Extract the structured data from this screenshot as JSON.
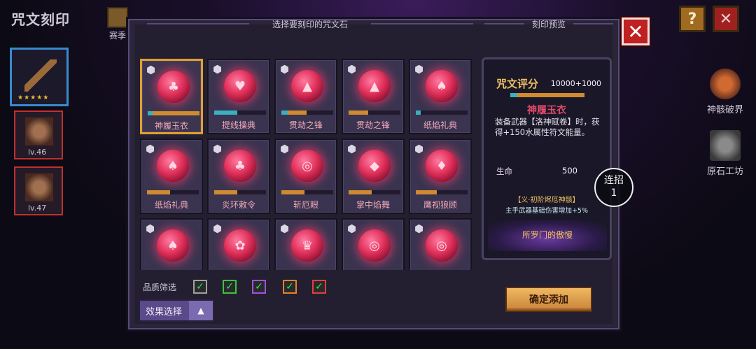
{
  "background": {
    "title": "咒文刻印",
    "season_label": "赛季",
    "hero_levels": [
      "lv.46",
      "lv.47"
    ],
    "side_features": [
      "神骸破界",
      "原石工坊"
    ],
    "help_label": "?",
    "close_label": "✕"
  },
  "panel": {
    "left_header": "选择要刻印的咒文石",
    "right_header": "刻印预览",
    "close_label": "✕"
  },
  "runes": [
    {
      "name": "神履玉衣",
      "glyph": "♣",
      "bar_color": "#d08a30",
      "progress": 1.0,
      "cyan": 0.1,
      "selected": true
    },
    {
      "name": "提线操典",
      "glyph": "♥",
      "bar_color": "#d08a30",
      "progress": 0.45,
      "cyan": 0.45,
      "selected": false
    },
    {
      "name": "贯劫之锋",
      "glyph": "▲",
      "bar_color": "#d08a30",
      "progress": 0.48,
      "cyan": 0.12,
      "selected": false
    },
    {
      "name": "贯劫之锋",
      "glyph": "▲",
      "bar_color": "#d08a30",
      "progress": 0.38,
      "cyan": 0.0,
      "selected": false
    },
    {
      "name": "纸焰礼典",
      "glyph": "♠",
      "bar_color": "#d08a30",
      "progress": 0.1,
      "cyan": 0.1,
      "selected": false
    },
    {
      "name": "纸焰礼典",
      "glyph": "♠",
      "bar_color": "#d08a30",
      "progress": 0.45,
      "cyan": 0.0,
      "selected": false
    },
    {
      "name": "炎环敕令",
      "glyph": "♣",
      "bar_color": "#d08a30",
      "progress": 0.45,
      "cyan": 0.0,
      "selected": false
    },
    {
      "name": "斩厄眼",
      "glyph": "◎",
      "bar_color": "#d08a30",
      "progress": 0.45,
      "cyan": 0.0,
      "selected": false
    },
    {
      "name": "掌中焰舞",
      "glyph": "◆",
      "bar_color": "#d08a30",
      "progress": 0.45,
      "cyan": 0.0,
      "selected": false
    },
    {
      "name": "鹰视狼顾",
      "glyph": "♦",
      "bar_color": "#d08a30",
      "progress": 0.4,
      "cyan": 0.0,
      "selected": false
    },
    {
      "name": "",
      "glyph": "♠",
      "bar_color": "#d08a30",
      "progress": 0,
      "cyan": 0,
      "selected": false
    },
    {
      "name": "",
      "glyph": "✿",
      "bar_color": "#d08a30",
      "progress": 0,
      "cyan": 0,
      "selected": false
    },
    {
      "name": "",
      "glyph": "♛",
      "bar_color": "#d08a30",
      "progress": 0,
      "cyan": 0,
      "selected": false
    },
    {
      "name": "",
      "glyph": "◎",
      "bar_color": "#d08a30",
      "progress": 0,
      "cyan": 0,
      "selected": false
    },
    {
      "name": "",
      "glyph": "◎",
      "bar_color": "#d08a30",
      "progress": 0,
      "cyan": 0,
      "selected": false
    }
  ],
  "preview": {
    "score_label": "咒文评分",
    "score_value": "10000+1000",
    "rune_name": "神履玉衣",
    "description": "装备武器【洛神赋卷】时，获得+150水属性符文能量。",
    "stat_key": "生命",
    "stat_value": "500",
    "tag_title": "【义·初阶烬厄神骸】",
    "tag_desc": "主手武器基础伤害增加+5%",
    "seal_label": "所罗门的傲慢"
  },
  "combo": {
    "label": "连招",
    "count": "1"
  },
  "filter": {
    "label": "品质筛选",
    "checks": [
      "✓",
      "✓",
      "✓",
      "✓",
      "✓"
    ],
    "quality_colors": [
      "#a0a0a0",
      "#40c040",
      "#a050e0",
      "#e08030",
      "#e04040"
    ]
  },
  "effect_button": {
    "label": "效果选择",
    "caret": "▲"
  },
  "confirm_button": {
    "label": "确定添加"
  }
}
